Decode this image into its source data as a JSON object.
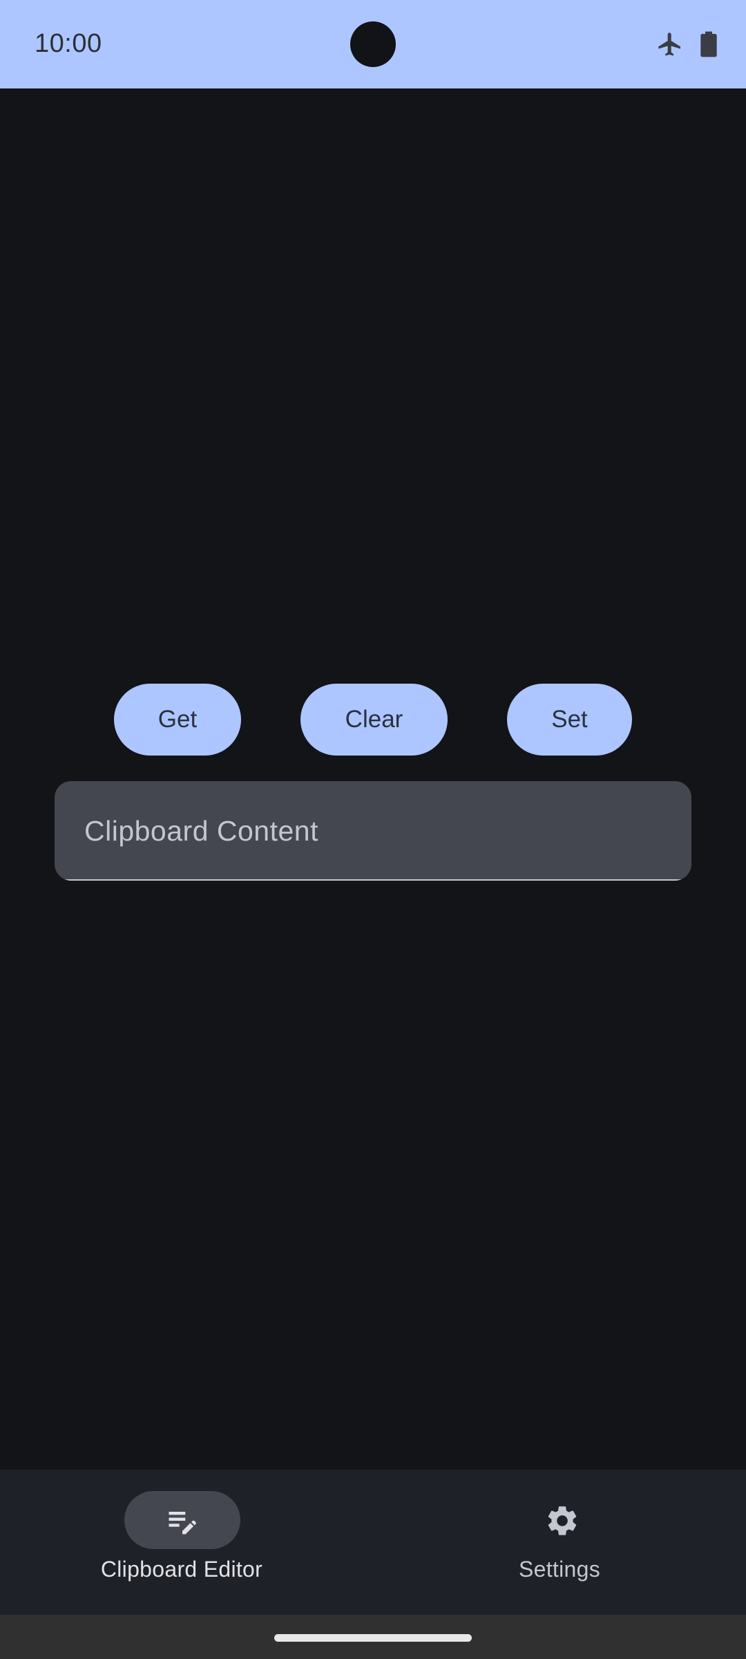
{
  "status_bar": {
    "time": "10:00",
    "icons": [
      "airplane-mode-icon",
      "battery-icon"
    ],
    "background": "#adc6ff"
  },
  "actions": {
    "get_label": "Get",
    "clear_label": "Clear",
    "set_label": "Set"
  },
  "clipboard_field": {
    "placeholder": "Clipboard Content",
    "value": ""
  },
  "bottom_nav": {
    "items": [
      {
        "label": "Clipboard Editor",
        "icon": "edit-note-icon",
        "selected": true
      },
      {
        "label": "Settings",
        "icon": "gear-icon",
        "selected": false
      }
    ]
  },
  "colors": {
    "accent": "#adc6ff",
    "background": "#131418",
    "surface": "#1f2128",
    "field": "#44474f"
  }
}
